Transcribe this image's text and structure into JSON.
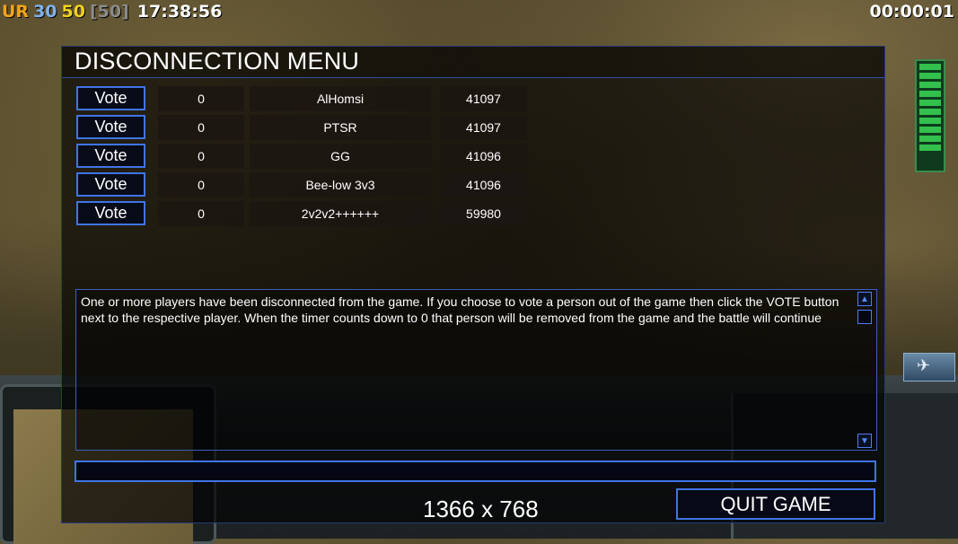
{
  "hud": {
    "label_ur": "UR",
    "value_a": "30",
    "value_b": "50",
    "value_c": "[50]",
    "clock": "17:38:56",
    "timer": "00:00:01"
  },
  "dialog": {
    "title": "DISCONNECTION MENU",
    "players": [
      {
        "vote_label": "Vote",
        "votes": "0",
        "name": "AlHomsi",
        "id": "41097"
      },
      {
        "vote_label": "Vote",
        "votes": "0",
        "name": "PTSR",
        "id": "41097"
      },
      {
        "vote_label": "Vote",
        "votes": "0",
        "name": "GG",
        "id": "41096"
      },
      {
        "vote_label": "Vote",
        "votes": "0",
        "name": "Bee-low 3v3",
        "id": "41096"
      },
      {
        "vote_label": "Vote",
        "votes": "0",
        "name": "2v2v2++++++",
        "id": "59980"
      }
    ],
    "message": "One or more players have been disconnected from the game. If you choose to vote a person out of the game then click the VOTE  button next to the respective player. When the timer counts down to 0 that person will be removed from the game and the battle will  continue",
    "resolution": "1366 x 768",
    "quit_label": "QUIT GAME"
  },
  "colors": {
    "accent_blue": "#3f74e6",
    "hud_orange": "#f2a41c",
    "hud_yellow": "#f0d21e"
  }
}
